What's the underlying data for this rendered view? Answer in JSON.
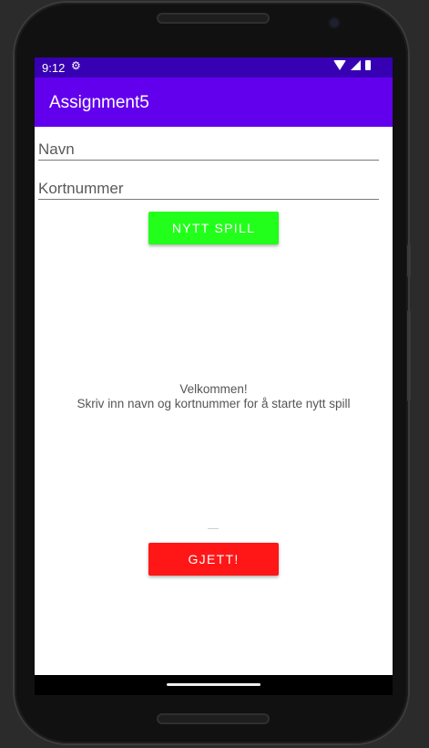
{
  "device": {
    "top_speaker_icon": "speaker-grille",
    "bottom_speaker_icon": "speaker-grille",
    "camera_icon": "front-camera"
  },
  "status_bar": {
    "time": "9:12",
    "notification_icon": "gear-icon",
    "wifi_icon": "wifi-icon",
    "signal_icon": "signal-icon",
    "battery_icon": "battery-icon",
    "color": "#3700b3"
  },
  "app_bar": {
    "title": "Assignment5",
    "color": "#6200ee"
  },
  "form": {
    "name_placeholder": "Navn",
    "name_value": "",
    "card_placeholder": "Kortnummer",
    "card_value": ""
  },
  "new_game_button": {
    "label": "NYTT SPILL",
    "color": "#22ff1a"
  },
  "message": {
    "line1": "Velkommen!",
    "line2": "Skriv inn navn og kortnummer for å starte nytt spill"
  },
  "guess_button": {
    "label": "GJETT!",
    "color": "#ff1717"
  },
  "nav_bar": {
    "home_icon": "home-gesture-pill"
  }
}
